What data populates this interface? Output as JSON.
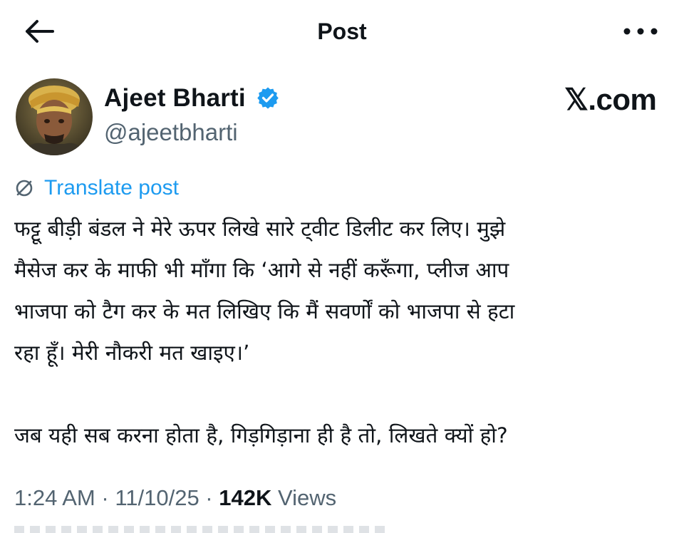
{
  "header": {
    "title": "Post"
  },
  "author": {
    "name": "Ajeet Bharti",
    "handle": "@ajeetbharti",
    "verified": true
  },
  "brand": "𝕏.com",
  "translate_label": "Translate post",
  "post": {
    "lines": [
      "फट्टू बीड़ी बंडल ने मेरे ऊपर लिखे सारे ट्वीट डिलीट कर लिए। मुझे",
      "मैसेज कर के माफी भी माँगा कि ‘आगे से नहीं करूँगा, प्लीज आप",
      "भाजपा को टैग कर के मत लिखिए कि मैं सवर्णों को भाजपा से हटा",
      "रहा हूँ। मेरी नौकरी मत खाइए।’",
      "जब यही सब करना होता है, गिड़गिड़ाना ही है तो, लिखते क्यों हो?"
    ]
  },
  "meta": {
    "time": "1:24 AM",
    "separator": " · ",
    "date": "11/10/25",
    "views_count": "142K",
    "views_label": " Views"
  },
  "colors": {
    "accent": "#1d9bf0",
    "text": "#0f1419",
    "muted": "#536471"
  },
  "icons": {
    "back": "back-arrow-icon",
    "more": "more-dots-icon",
    "verified": "verified-badge-icon",
    "translate": "translate-globe-icon"
  }
}
